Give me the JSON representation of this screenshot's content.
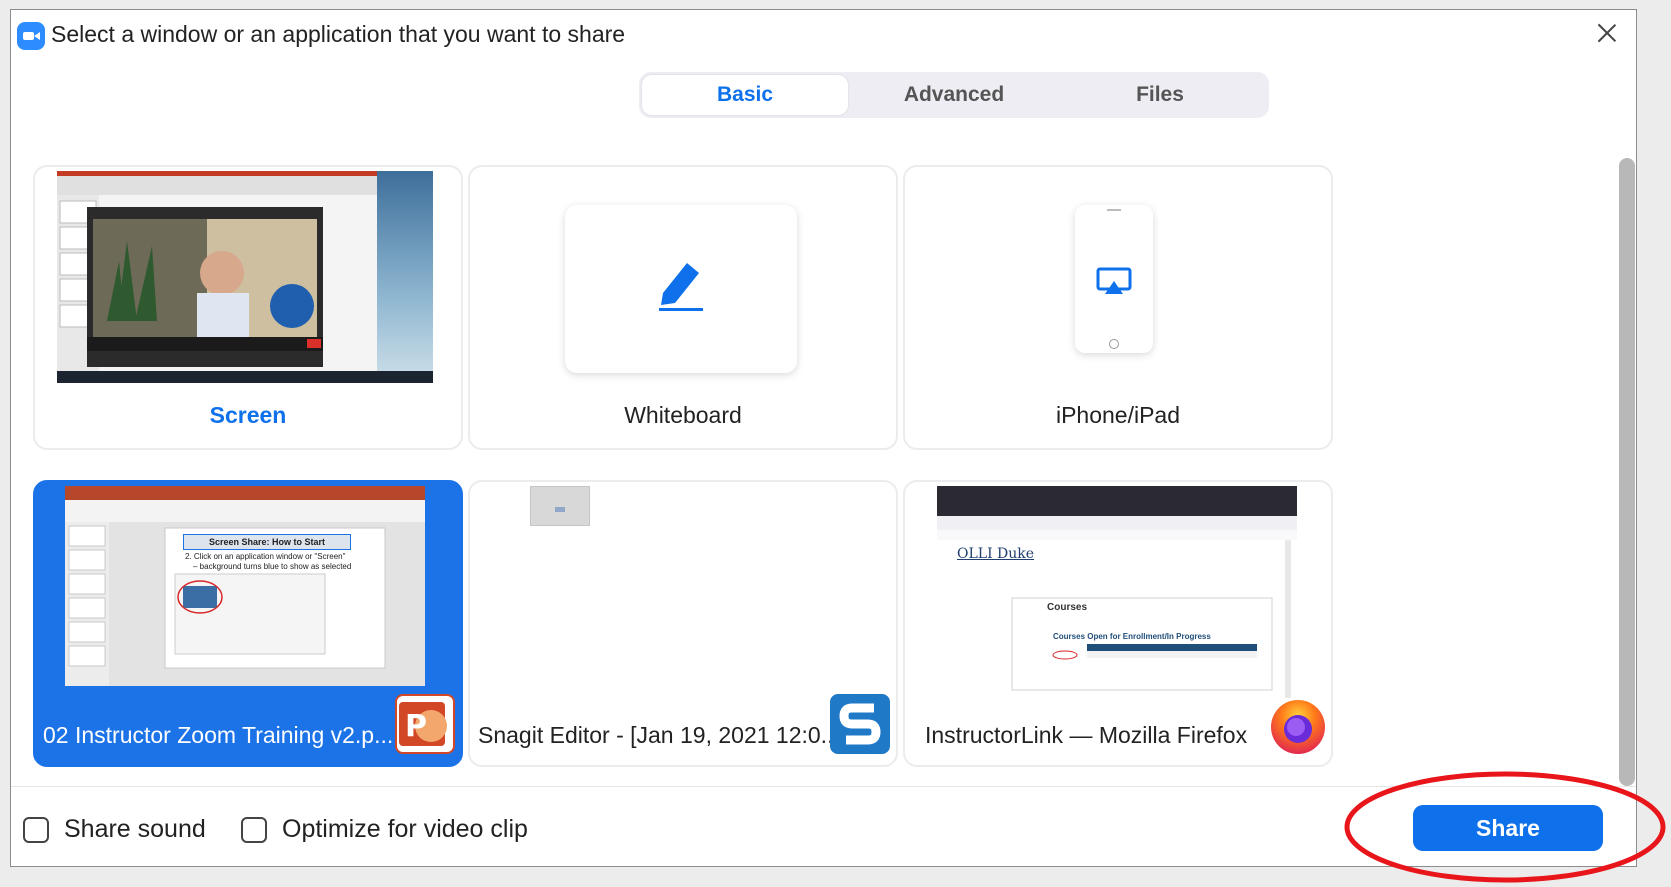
{
  "title_bar": {
    "title": "Select a window or an application that you want to share",
    "zoom_icon": "zoom-camera-icon",
    "close_icon": "close-icon"
  },
  "tabs": [
    {
      "label": "Basic",
      "active": true
    },
    {
      "label": "Advanced",
      "active": false
    },
    {
      "label": "Files",
      "active": false
    }
  ],
  "cards": {
    "screen": {
      "label": "Screen",
      "selected": false
    },
    "whiteboard": {
      "label": "Whiteboard",
      "icon": "pen-icon"
    },
    "iphone": {
      "label": "iPhone/iPad",
      "icon": "airplay-phone-icon"
    }
  },
  "apps": [
    {
      "label": "02 Instructor Zoom Training v2.p...",
      "icon": "powerpoint-icon",
      "selected": true,
      "thumb_title": "Screen Share: How to Start",
      "thumb_lines": [
        "2. Click on an application window or \"Screen\"",
        "– background turns blue to show as selected"
      ]
    },
    {
      "label": "Snagit Editor - [Jan 19, 2021 12:0...",
      "icon": "snagit-icon",
      "selected": false
    },
    {
      "label": "InstructorLink — Mozilla Firefox",
      "icon": "firefox-icon",
      "selected": false,
      "thumb_logo": "OLLI Duke",
      "thumb_heading": "Courses",
      "thumb_subheading": "Courses Open for Enrollment/In Progress"
    }
  ],
  "footer": {
    "share_sound_label": "Share sound",
    "share_sound_checked": false,
    "optimize_label": "Optimize for video clip",
    "optimize_checked": false,
    "share_button": "Share"
  },
  "colors": {
    "accent": "#0e71eb",
    "selected_card": "#1c73e8",
    "annotation": "#e8151b"
  }
}
